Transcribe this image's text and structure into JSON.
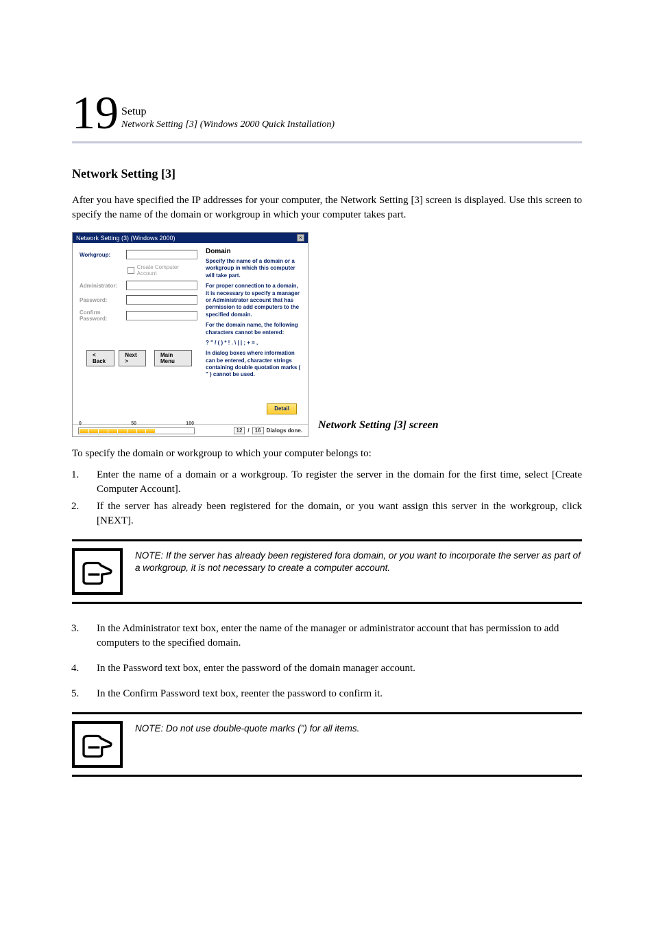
{
  "header": {
    "chapter_num": "19",
    "setup_label": "Setup",
    "subtitle": "Network Setting [3] (Windows 2000 Quick Installation)"
  },
  "heading": "Network Setting [3]",
  "intro": "After you have specified the IP addresses for your computer, the Network Setting [3] screen is displayed. Use this screen to specify the name of the domain or workgroup in which your computer takes part.",
  "dialog": {
    "titlebar": "Network Setting (3) (Windows 2000)",
    "labels": {
      "workgroup": "Workgroup:",
      "create_account": "Create Computer Account",
      "administrator": "Administrator:",
      "password": "Password:",
      "confirm_password": "Confirm Password:"
    },
    "right": {
      "heading": "Domain",
      "p1": "Specify the name of a domain or a workgroup in which this computer will take part.",
      "p2": "For proper connection to a domain, it is necessary to specify a manager or Administrator account that has permission to add computers to the specified domain.",
      "p3": "For the domain name, the following characters cannot be entered:",
      "chars": "? \" / ( ) * ! . \\ | | ; + = ,",
      "p4": "In dialog boxes where information can be entered, character strings containing double quotation marks ( \" ) cannot be used."
    },
    "buttons": {
      "back": "< Back",
      "next": "Next >",
      "main": "Main Menu",
      "detail": "Detail"
    },
    "status": {
      "p0": "0",
      "p50": "50",
      "p100": "100",
      "cur": "12",
      "sep": "/",
      "total": "16",
      "msg": "Dialogs done."
    }
  },
  "caption": "Network Setting [3] screen",
  "list_intro": "To specify the domain or workgroup to which your computer belongs to:",
  "step1": "Enter the name of a domain or a workgroup. To register the server in the domain for the first time, select [Create Computer Account].",
  "step2": "If the server has already been registered for the domain, or you want assign this server in the workgroup, click [NEXT].",
  "note1": "NOTE: If the server has already been registered fora domain, or you want to incorporate the server as part of a workgroup, it is not necessary to create a computer account.",
  "step3": "In the Administrator text box, enter the name of the manager or administrator account that has permission to add computers to the specified domain.",
  "step4": "In the Password text box, enter the password of the domain manager account.",
  "step5": "In the Confirm Password text box, reenter the password to confirm it.",
  "note2": "NOTE: Do not use double-quote marks (\") for all items."
}
